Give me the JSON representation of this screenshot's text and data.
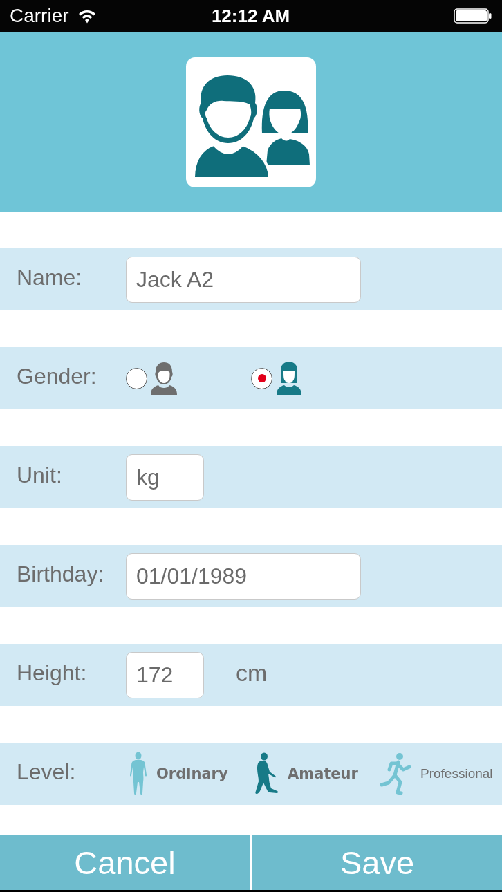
{
  "status_bar": {
    "carrier": "Carrier",
    "time": "12:12 AM"
  },
  "form": {
    "name": {
      "label": "Name:",
      "value": "Jack A2"
    },
    "gender": {
      "label": "Gender:",
      "options": [
        {
          "selected": false
        },
        {
          "selected": true
        }
      ]
    },
    "unit": {
      "label": "Unit:",
      "value": "kg"
    },
    "birthday": {
      "label": "Birthday:",
      "value": "01/01/1989"
    },
    "height": {
      "label": "Height:",
      "value": "172",
      "suffix": "cm"
    },
    "level": {
      "label": "Level:",
      "options": [
        {
          "label": "Ordinary",
          "selected": false
        },
        {
          "label": "Amateur",
          "selected": true
        },
        {
          "label": "Professional",
          "selected": false
        }
      ]
    }
  },
  "buttons": [
    {
      "label": "Cancel"
    },
    {
      "label": "Save"
    }
  ]
}
